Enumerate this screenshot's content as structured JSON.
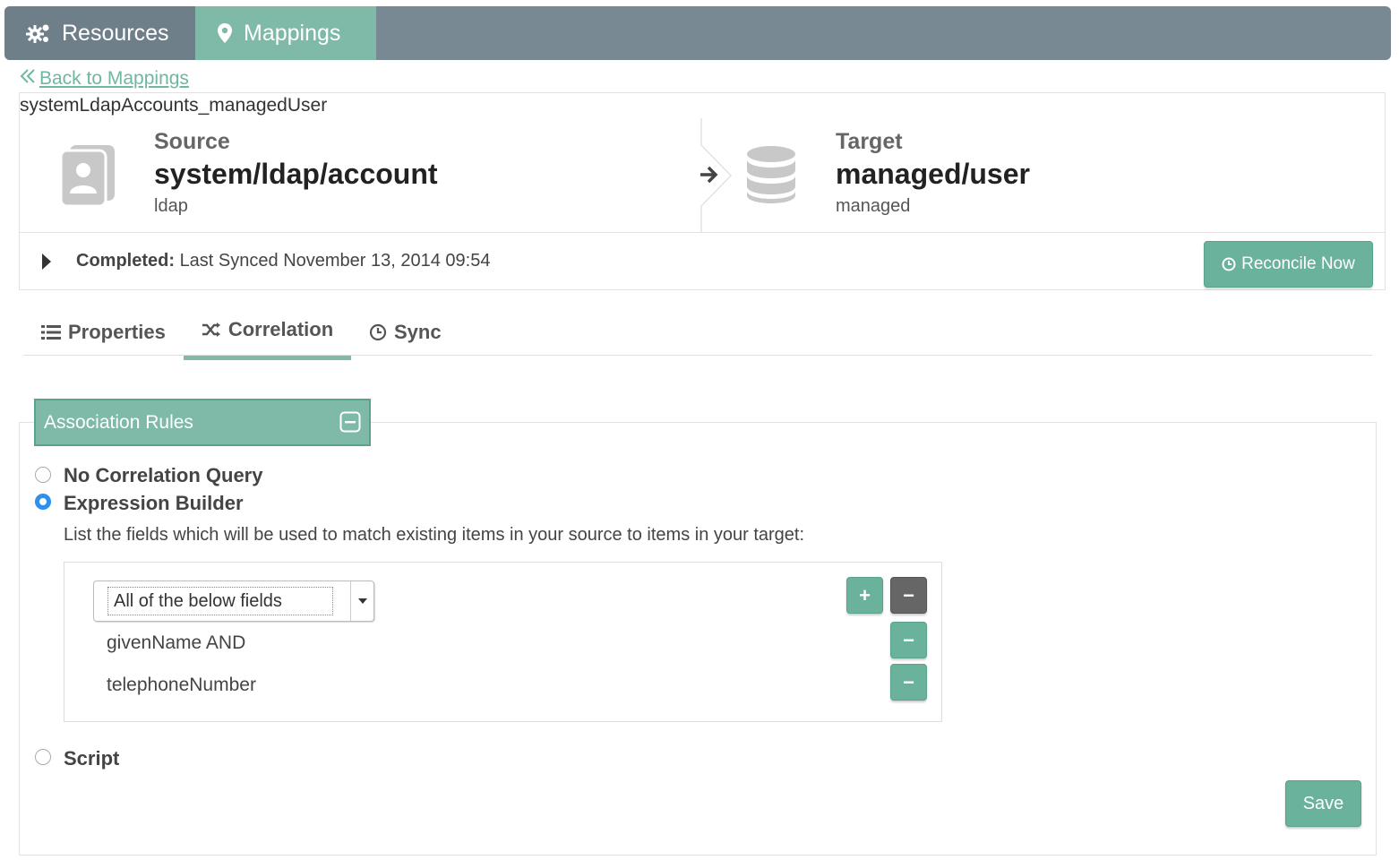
{
  "nav": {
    "tabs": [
      {
        "label": "Resources",
        "icon": "gears-icon"
      },
      {
        "label": "Mappings",
        "icon": "map-marker-icon"
      }
    ]
  },
  "back_link": "Back to Mappings",
  "mapping_name": "systemLdapAccounts_managedUser",
  "source": {
    "label": "Source",
    "name": "system/ldap/account",
    "type": "ldap"
  },
  "target": {
    "label": "Target",
    "name": "managed/user",
    "type": "managed"
  },
  "status": {
    "label": "Completed:",
    "text": "Last Synced November 13, 2014 09:54"
  },
  "reconcile_button": "Reconcile Now",
  "tabs": [
    {
      "label": "Properties",
      "icon": "list-icon"
    },
    {
      "label": "Correlation",
      "icon": "shuffle-icon",
      "active": true
    },
    {
      "label": "Sync",
      "icon": "clock-icon"
    }
  ],
  "association": {
    "title": "Association Rules",
    "options": [
      {
        "label": "No Correlation Query",
        "checked": false
      },
      {
        "label": "Expression Builder",
        "checked": true
      },
      {
        "label": "Script",
        "checked": false
      }
    ],
    "help_text": "List the fields which will be used to match existing items in your source to items in your target:",
    "select_value": "All of the below fields",
    "fields": [
      "givenName AND",
      "telephoneNumber"
    ],
    "add_symbol": "+",
    "remove_symbol": "−"
  },
  "save_button": "Save",
  "colors": {
    "navbar": "#788994",
    "accent": "#7fbaa8",
    "button": "#6ab29c",
    "radio_checked": "#2d8ff0"
  }
}
